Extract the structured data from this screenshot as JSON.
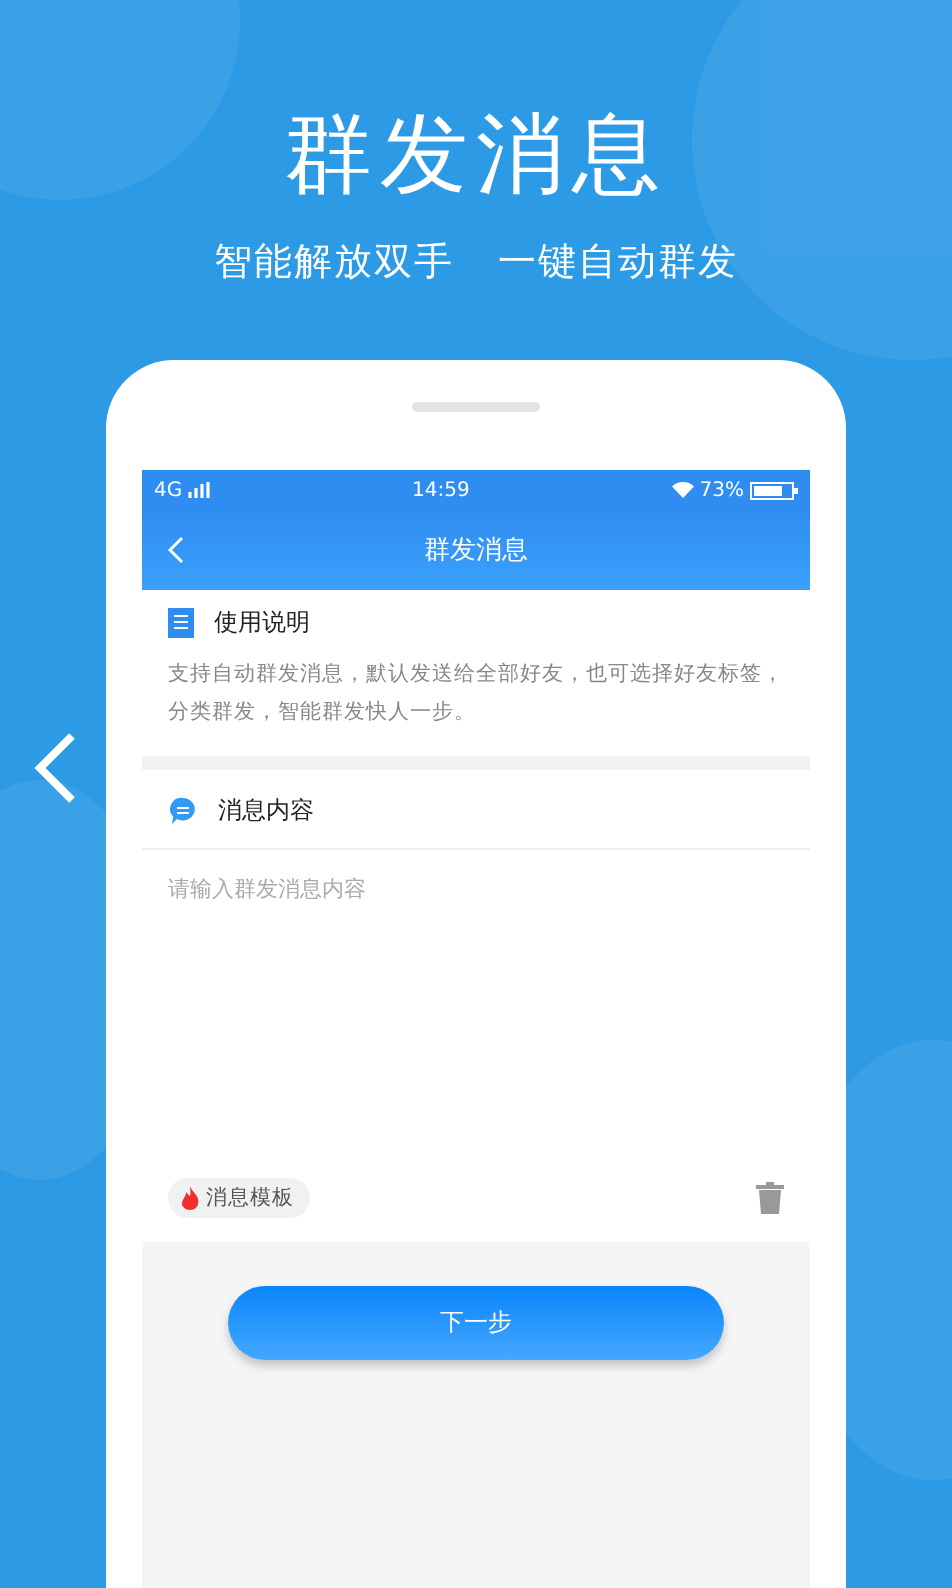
{
  "promo": {
    "title": "群发消息",
    "subtitle": [
      "智能解放双手",
      "一键自动群发"
    ]
  },
  "status_bar": {
    "network": "4G",
    "time": "14:59",
    "battery": "73%"
  },
  "nav": {
    "title": "群发消息"
  },
  "instructions": {
    "title": "使用说明",
    "body": "支持自动群发消息，默认发送给全部好友，也可选择好友标签，分类群发，智能群发快人一步。"
  },
  "message": {
    "title": "消息内容",
    "placeholder": "请输入群发消息内容"
  },
  "template_chip": "消息模板",
  "next_button": "下一步"
}
